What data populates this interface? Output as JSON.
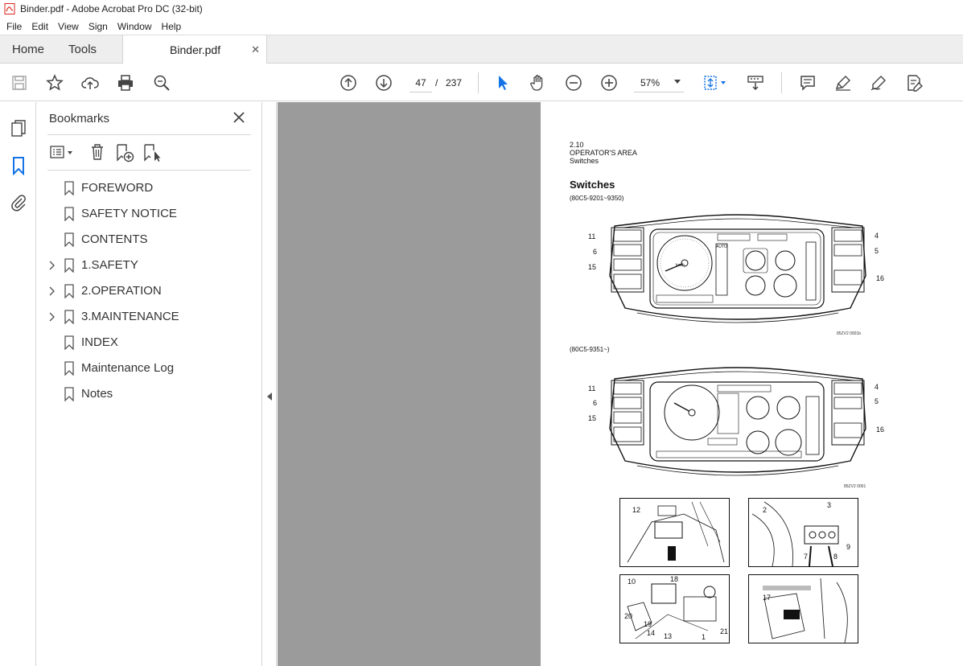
{
  "window": {
    "title": "Binder.pdf - Adobe Acrobat Pro DC (32-bit)"
  },
  "menu": [
    "File",
    "Edit",
    "View",
    "Sign",
    "Window",
    "Help"
  ],
  "tabs": {
    "home": "Home",
    "tools": "Tools",
    "document": "Binder.pdf"
  },
  "toolbar": {
    "current_page": "47",
    "page_sep": "/",
    "total_pages": "237",
    "zoom": "57%"
  },
  "bookmarks": {
    "title": "Bookmarks",
    "items": [
      {
        "label": "FOREWORD",
        "expandable": false
      },
      {
        "label": "SAFETY NOTICE",
        "expandable": false
      },
      {
        "label": "CONTENTS",
        "expandable": false
      },
      {
        "label": "1.SAFETY",
        "expandable": true
      },
      {
        "label": "2.OPERATION",
        "expandable": true
      },
      {
        "label": "3.MAINTENANCE",
        "expandable": true
      },
      {
        "label": "INDEX",
        "expandable": false
      },
      {
        "label": "Maintenance Log",
        "expandable": false
      },
      {
        "label": "Notes",
        "expandable": false
      }
    ]
  },
  "page": {
    "section_number": "2.10",
    "section_title": "OPERATOR'S AREA",
    "section_sub": "Switches",
    "heading": "Switches",
    "variant1": "(80C5-9201~9350)",
    "variant2": "(80C5-9351~)",
    "fig1_caption": "85ZV2 0001b",
    "fig2_caption": "85ZV2 0001",
    "callouts_top": {
      "c11": "11",
      "c6": "6",
      "c15": "15",
      "c4": "4",
      "c5": "5",
      "c16": "16"
    },
    "callouts_photos": {
      "p12": "12",
      "p2": "2",
      "p3": "3",
      "p7": "7",
      "p8": "8",
      "p9": "9",
      "p10": "10",
      "p18": "18",
      "p20": "20",
      "p19": "19",
      "p14": "14",
      "p13": "13",
      "p1": "1",
      "p21": "21",
      "p17": "17"
    },
    "speedo_ticks": [
      "20",
      "30",
      "40",
      "10",
      "50"
    ],
    "speedo_unit": "km/h",
    "auto_label": "AUTO"
  },
  "colors": {
    "accent": "#1473e6",
    "toolbar_bg": "#ffffff",
    "tab_bg": "#eeeeee",
    "doc_bg": "#9b9b9b",
    "title_icon": "#d9251c"
  }
}
